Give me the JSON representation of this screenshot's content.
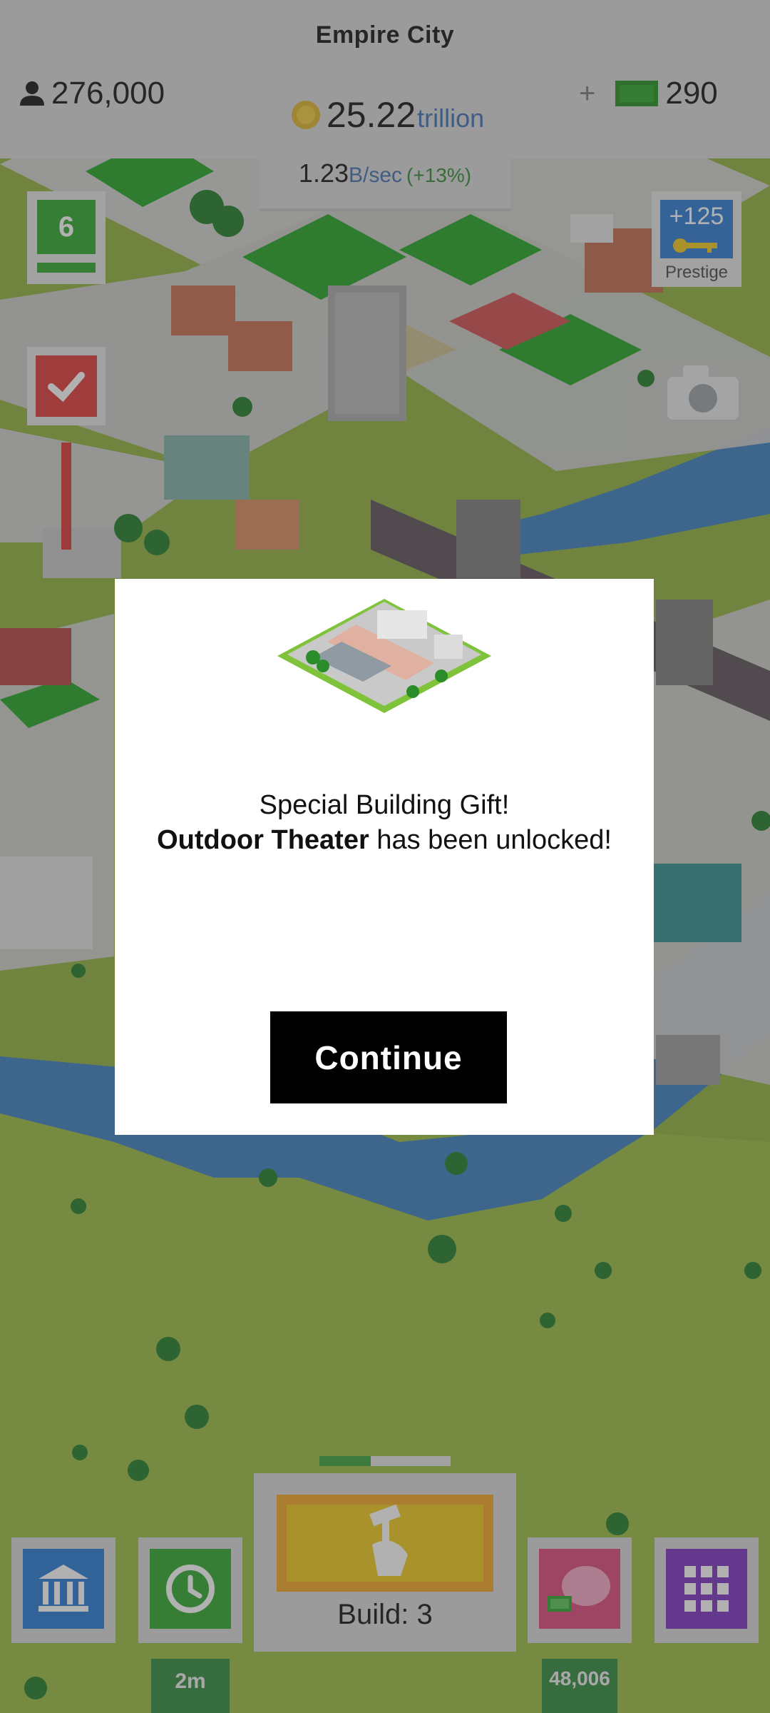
{
  "header": {
    "city_name": "Empire City",
    "population": "276,000",
    "coins_value": "25.22",
    "coins_unit": "trillion",
    "income_value": "1.23",
    "income_unit": "B/sec",
    "income_change": "(+13%)",
    "cash_plus": "+",
    "cash_value": "290"
  },
  "side_left": {
    "level_badge": "6"
  },
  "side_right": {
    "prestige_value": "+125",
    "prestige_label": "Prestige"
  },
  "modal": {
    "line1": "Special Building Gift!",
    "building_name": "Outdoor Theater",
    "line2_suffix": " has been unlocked!",
    "continue_label": "Continue"
  },
  "bottom_bar": {
    "build_label": "Build: 3",
    "timer_label": "2m",
    "savings_value": "48,006"
  },
  "colors": {
    "accent_green": "#2e8b3a",
    "accent_blue": "#3e6fb0",
    "build_yellow": "#f2c81a",
    "build_orange": "#f5a623",
    "piggy_pink": "#e0457b",
    "grid_purple": "#7b2fbf",
    "bank_blue": "#2377d4",
    "modal_button": "#000000"
  },
  "icons": {
    "population": "person-icon",
    "coins": "coin-icon",
    "cash": "cash-icon",
    "camera": "camera-icon",
    "checklist": "check-icon",
    "bank": "bank-icon",
    "history": "clock-icon",
    "piggy_bank": "piggy-bank-icon",
    "grid": "grid-icon",
    "build": "hammer-hand-icon"
  }
}
